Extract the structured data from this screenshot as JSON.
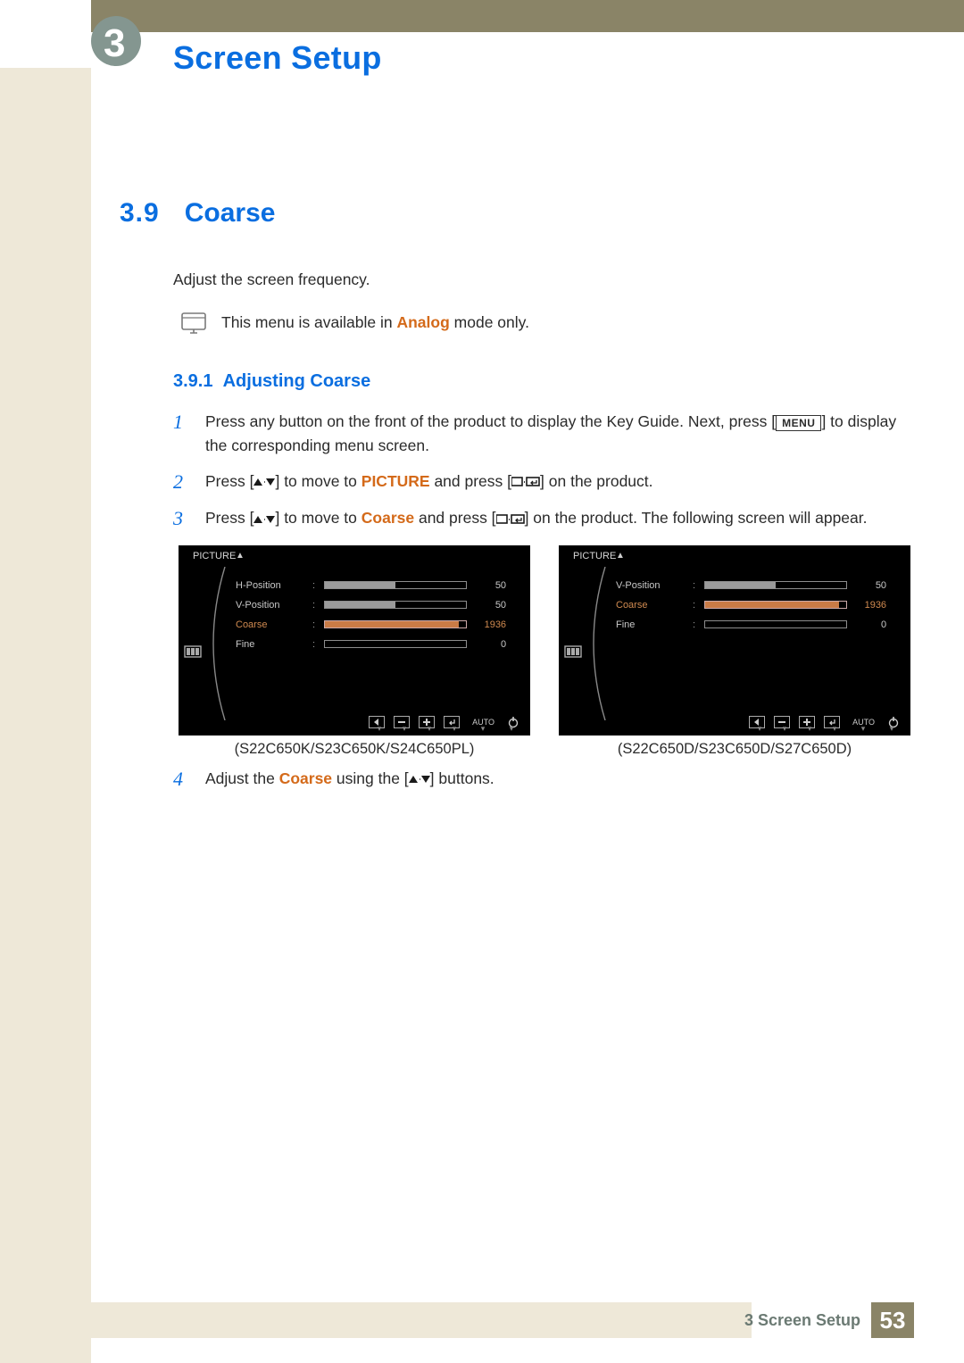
{
  "header": {
    "chapter_number": "3",
    "chapter_title": "Screen Setup"
  },
  "section": {
    "number": "3.9",
    "title": "Coarse",
    "lead": "Adjust the screen frequency.",
    "note_prefix": "This menu is available in ",
    "note_highlight": "Analog",
    "note_suffix": " mode only."
  },
  "subsection": {
    "number": "3.9.1",
    "title": "Adjusting Coarse"
  },
  "steps": {
    "s1": {
      "num": "1",
      "a": "Press any button on the front of the product to display the Key Guide. Next, press [",
      "menu": "MENU",
      "b": "] to display the corresponding menu screen."
    },
    "s2": {
      "num": "2",
      "a": "Press [",
      "b": "] to move to ",
      "hw": "PICTURE",
      "c": " and press [",
      "d": "] on the product."
    },
    "s3": {
      "num": "3",
      "a": "Press [",
      "b": "] to move to ",
      "hw": "Coarse",
      "c": " and press [",
      "d": "] on the product. The following screen will appear."
    },
    "s4": {
      "num": "4",
      "a": "Adjust the ",
      "hw": "Coarse",
      "b": " using the [",
      "c": "] buttons."
    }
  },
  "osd": {
    "title": "PICTURE",
    "auto": "AUTO",
    "left": {
      "items": [
        {
          "label": "H-Position",
          "value": "50",
          "fill": 50,
          "hi": false
        },
        {
          "label": "V-Position",
          "value": "50",
          "fill": 50,
          "hi": false
        },
        {
          "label": "Coarse",
          "value": "1936",
          "fill": 95,
          "hi": true
        },
        {
          "label": "Fine",
          "value": "0",
          "fill": 0,
          "hi": false
        }
      ],
      "caption": "(S22C650K/S23C650K/S24C650PL)"
    },
    "right": {
      "items": [
        {
          "label": "V-Position",
          "value": "50",
          "fill": 50,
          "hi": false
        },
        {
          "label": "Coarse",
          "value": "1936",
          "fill": 95,
          "hi": true
        },
        {
          "label": "Fine",
          "value": "0",
          "fill": 0,
          "hi": false
        }
      ],
      "caption": "(S22C650D/S23C650D/S27C650D)"
    }
  },
  "footer": {
    "chapter_label": "3 Screen Setup",
    "page": "53"
  }
}
